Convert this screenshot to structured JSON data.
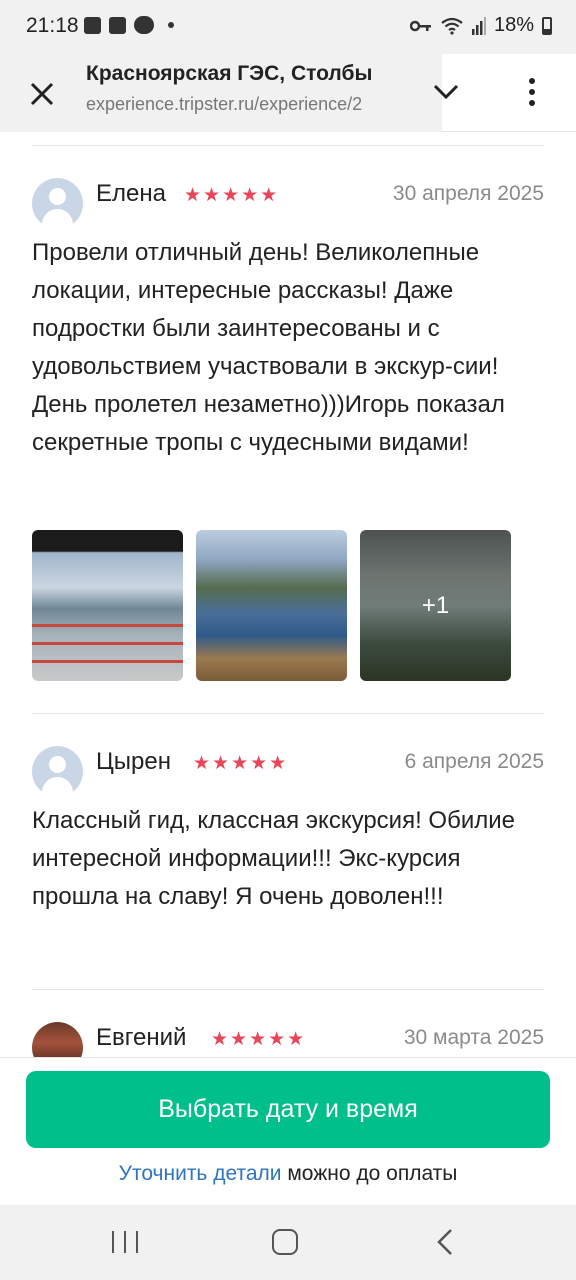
{
  "status_bar": {
    "time": "21:18",
    "battery": "18%",
    "icons": [
      "image-icon",
      "check-icon",
      "chat-icon",
      "dot-icon",
      "key-icon",
      "wifi-icon",
      "signal-icon",
      "battery-icon"
    ]
  },
  "browser": {
    "title": "Красноярская ГЭС, Столбы",
    "url": "experience.tripster.ru/experience/2"
  },
  "reviews": [
    {
      "name": "Елена",
      "stars": "★★★★★",
      "date": "30 апреля 2025",
      "text": "Провели отличный день! Великолепные локации, интересные рассказы! Даже подростки были заинтересованы и с удовольствием участвовали в экскур-сии!День пролетел незаметно)))Игорь показал секретные тропы с чудесными видами!",
      "photos_more": "+1"
    },
    {
      "name": "Цырен",
      "stars": "★★★★★",
      "date": "6 апреля 2025",
      "text": "Классный гид, классная экскурсия! Обилие интересной информации!!! Экс-курсия прошла на славу! Я очень доволен!!!"
    },
    {
      "name": "Евгений",
      "stars": "★★★★★",
      "date": "30 марта 2025"
    }
  ],
  "cta": {
    "button_label": "Выбрать дату и время",
    "note_link": "Уточнить детали",
    "note_rest": " можно до оплаты"
  },
  "colors": {
    "accent_green": "#00bf8a",
    "star_red": "#e8475a",
    "link_blue": "#2f74c0"
  }
}
